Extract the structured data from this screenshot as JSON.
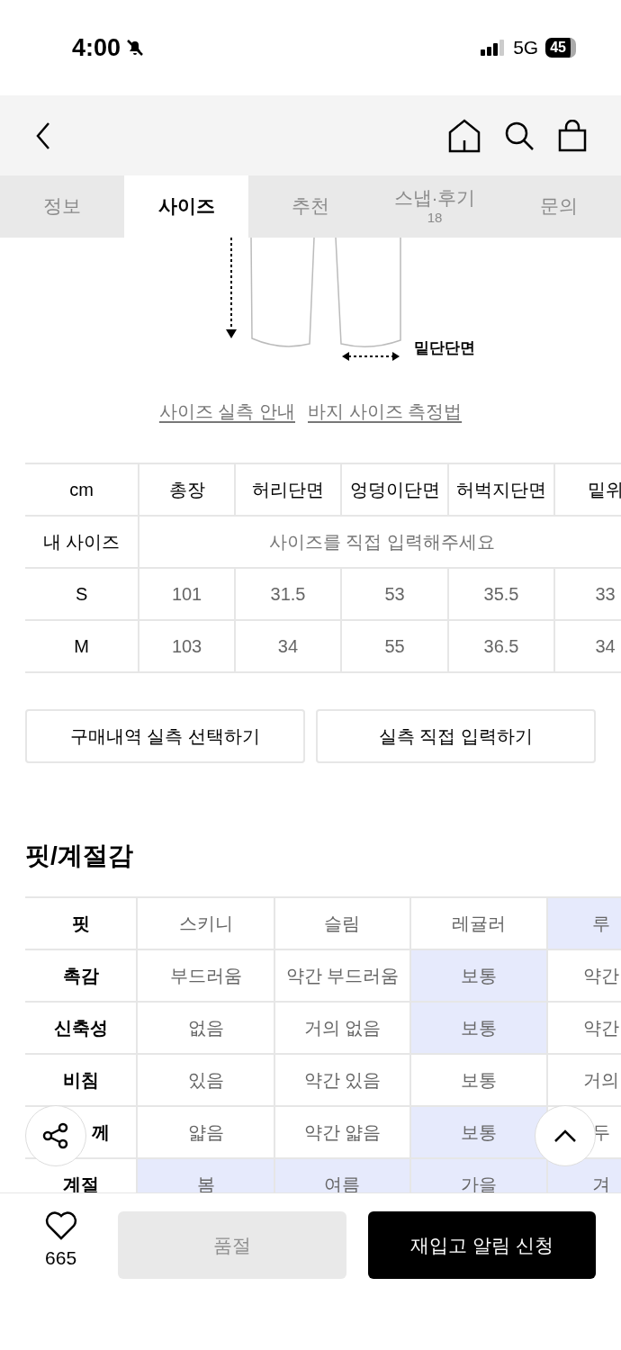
{
  "status_bar": {
    "time": "4:00",
    "network": "5G",
    "battery": "45"
  },
  "tabs": [
    {
      "label": "정보",
      "selected": false
    },
    {
      "label": "사이즈",
      "selected": true
    },
    {
      "label": "추천",
      "selected": false
    },
    {
      "label": "스냅·후기",
      "count": "18",
      "selected": false
    },
    {
      "label": "문의",
      "selected": false
    }
  ],
  "diagram": {
    "label": "밑단단면"
  },
  "guide_links": [
    "사이즈 실측 안내",
    "바지 사이즈 측정법"
  ],
  "size_table": {
    "columns": [
      "cm",
      "총장",
      "허리단면",
      "엉덩이단면",
      "허벅지단면",
      "밑위"
    ],
    "my_size": {
      "label": "내 사이즈",
      "placeholder": "사이즈를 직접 입력해주세요"
    },
    "rows": [
      {
        "size": "S",
        "values": [
          "101",
          "31.5",
          "53",
          "35.5",
          "33"
        ]
      },
      {
        "size": "M",
        "values": [
          "103",
          "34",
          "55",
          "36.5",
          "34"
        ]
      }
    ]
  },
  "actions": [
    "구매내역 실측 선택하기",
    "실측 직접 입력하기"
  ],
  "fit": {
    "title": "핏/계절감",
    "rows": [
      {
        "label": "핏",
        "options": [
          {
            "text": "스키니",
            "selected": false
          },
          {
            "text": "슬림",
            "selected": false
          },
          {
            "text": "레귤러",
            "selected": false
          },
          {
            "text": "루",
            "selected": true
          }
        ]
      },
      {
        "label": "촉감",
        "options": [
          {
            "text": "부드러움",
            "selected": false
          },
          {
            "text": "약간 부드러움",
            "selected": false
          },
          {
            "text": "보통",
            "selected": true
          },
          {
            "text": "약간",
            "selected": false
          }
        ]
      },
      {
        "label": "신축성",
        "options": [
          {
            "text": "없음",
            "selected": false
          },
          {
            "text": "거의 없음",
            "selected": false
          },
          {
            "text": "보통",
            "selected": true
          },
          {
            "text": "약간",
            "selected": false
          }
        ]
      },
      {
        "label": "비침",
        "options": [
          {
            "text": "있음",
            "selected": false
          },
          {
            "text": "약간 있음",
            "selected": false
          },
          {
            "text": "보통",
            "selected": false
          },
          {
            "text": "거의",
            "selected": false
          }
        ]
      },
      {
        "label": "께",
        "kind": "covered",
        "options": [
          {
            "text": "얇음",
            "selected": false
          },
          {
            "text": "약간 얇음",
            "selected": false
          },
          {
            "text": "보통",
            "selected": true
          },
          {
            "text": "두",
            "selected": false
          }
        ]
      },
      {
        "label": "계절",
        "options": [
          {
            "text": "봄",
            "selected": true
          },
          {
            "text": "여름",
            "selected": true
          },
          {
            "text": "가을",
            "selected": true
          },
          {
            "text": "겨",
            "selected": true
          }
        ]
      }
    ]
  },
  "bottom_bar": {
    "likes": "665",
    "liked": false,
    "sold_out": "품절",
    "restock": "재입고 알림 신청"
  }
}
